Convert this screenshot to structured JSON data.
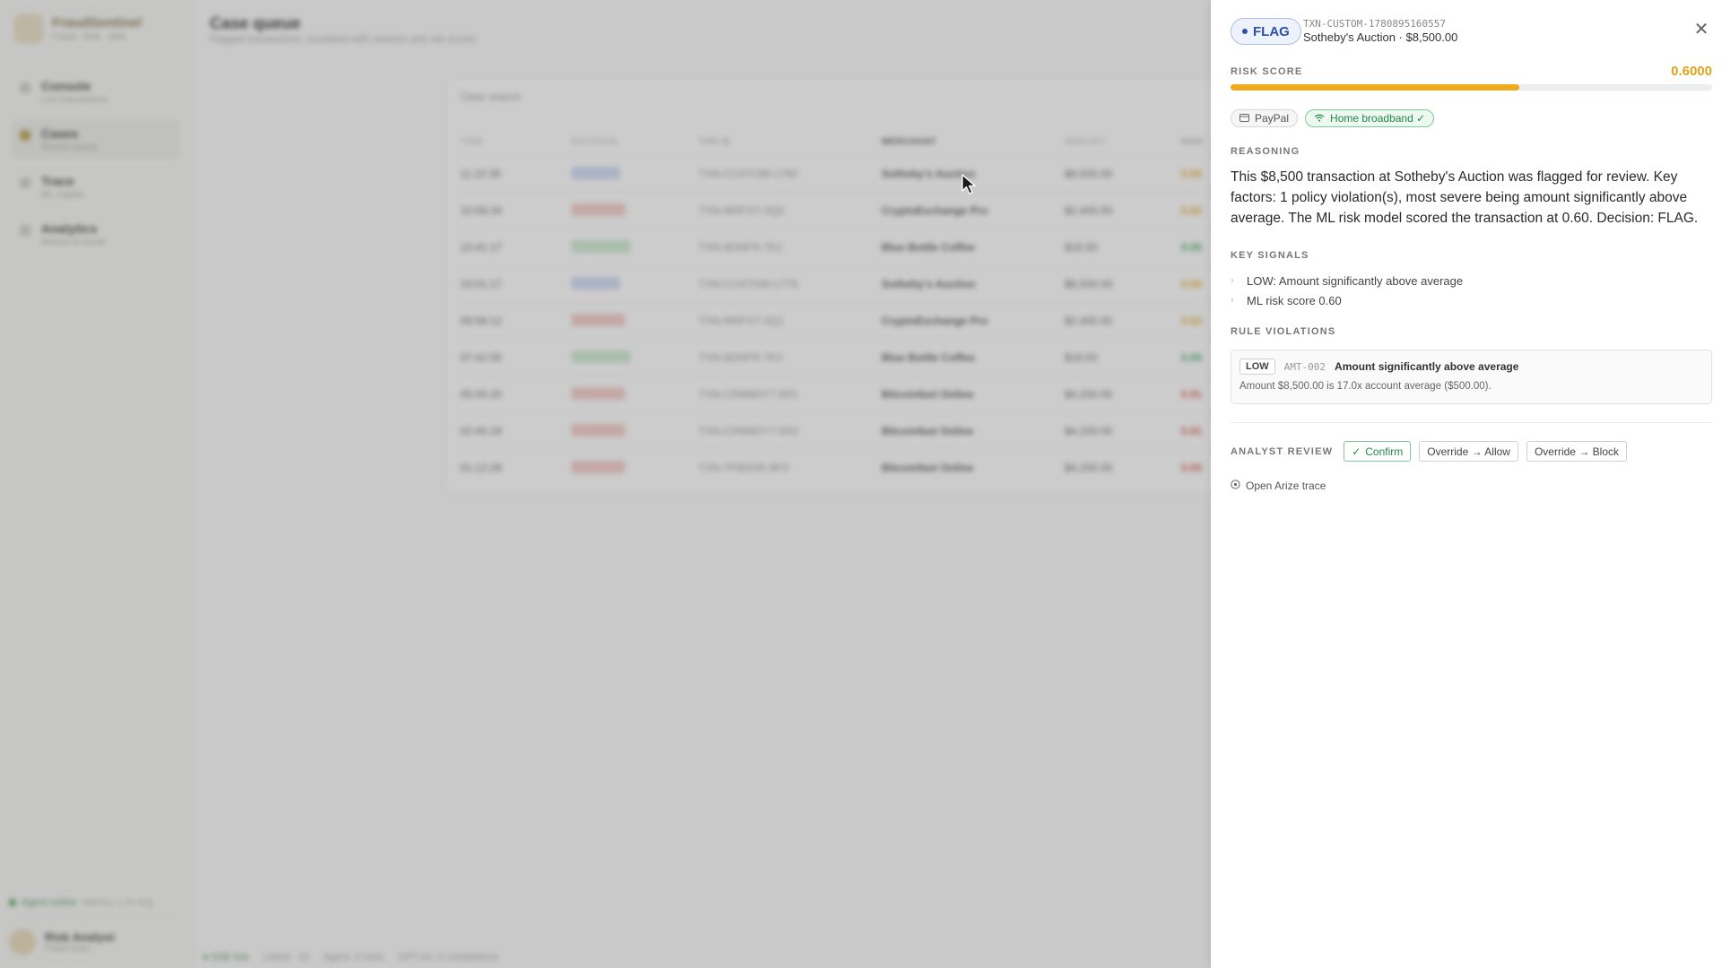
{
  "sidebar": {
    "brand": {
      "name": "FraudSentinel",
      "subtitle": "Fraud · Risk · AML"
    },
    "items": [
      {
        "label": "Console",
        "sub": "Live transactions"
      },
      {
        "label": "Cases",
        "sub": "Review queue"
      },
      {
        "label": "Trace",
        "sub": "ML explain"
      },
      {
        "label": "Analytics",
        "sub": "Metrics & trends"
      }
    ],
    "status": {
      "label": "Agent online",
      "detail": "latency 1.2s avg"
    },
    "user": {
      "name": "Risk Analyst",
      "role": "Fraud team"
    }
  },
  "main": {
    "title": "Case queue",
    "subtitle": "Flagged transactions, escalated with reasons and risk scores",
    "clear_label": "Clear search",
    "columns": [
      "TIME",
      "DECISION",
      "TXN ID",
      "MERCHANT",
      "AMOUNT",
      "RISK"
    ],
    "rows": [
      {
        "time": "11:22:35",
        "decision": "blue",
        "txn": "TXN-CUSTOM-1780",
        "merchant": "Sotheby's Auction",
        "amount": "$8,500.00",
        "risk": "0.60"
      },
      {
        "time": "10:58:34",
        "decision": "red",
        "txn": "TXN-MRFX7-3Q0",
        "merchant": "CryptoExchange Pro",
        "amount": "$2,400.00",
        "risk": "0.62"
      },
      {
        "time": "10:41:17",
        "decision": "green",
        "txn": "TXN-8DNFR-7K2",
        "merchant": "Blue Bottle Coffee",
        "amount": "$18.50",
        "risk": "0.05"
      },
      {
        "time": "10:01:17",
        "decision": "blue",
        "txn": "TXN-CUSTOM-1779",
        "merchant": "Sotheby's Auction",
        "amount": "$8,500.00",
        "risk": "0.60"
      },
      {
        "time": "09:58:12",
        "decision": "red",
        "txn": "TXN-MRFX7-3Q1",
        "merchant": "CryptoExchange Pro",
        "amount": "$2,400.00",
        "risk": "0.62"
      },
      {
        "time": "07:42:55",
        "decision": "green",
        "txn": "TXN-8DNFR-7K3",
        "merchant": "Blue Bottle Coffee",
        "amount": "$18.50",
        "risk": "0.05"
      },
      {
        "time": "05:05:20",
        "decision": "red",
        "txn": "TXN-CRM8DY7-5R1",
        "merchant": "Bitcoinfast Online",
        "amount": "$4,200.00",
        "risk": "0.91"
      },
      {
        "time": "02:45:18",
        "decision": "red",
        "txn": "TXN-CRM8DY7-5R2",
        "merchant": "Bitcoinfast Online",
        "amount": "$4,200.00",
        "risk": "0.91"
      },
      {
        "time": "01:12:28",
        "decision": "red",
        "txn": "TXN-7F8DHR-9P3",
        "merchant": "Bitcoinfast Online",
        "amount": "$4,200.00",
        "risk": "0.93"
      }
    ],
    "footer": [
      "● SSE live",
      "Latest · 2s",
      "Agent: 4 tools",
      "GPT-4o: 2 completions"
    ]
  },
  "drawer": {
    "decision": "FLAG",
    "txn_id": "TXN-CUSTOM-1780895160557",
    "merchant_amount": "Sotheby's Auction · $8,500.00",
    "risk_label": "RISK SCORE",
    "risk_value": "0.6000",
    "risk_fraction": 0.6,
    "chips": [
      {
        "label": "PayPal",
        "icon": "card-icon"
      },
      {
        "label": "Home broadband ✓",
        "icon": "wifi-icon"
      }
    ],
    "reasoning_label": "REASONING",
    "reasoning": "This $8,500 transaction at Sotheby's Auction was flagged for review. Key factors: 1 policy violation(s), most severe being amount significantly above average. The ML risk model scored the transaction at 0.60. Decision: FLAG.",
    "signals_label": "KEY SIGNALS",
    "signals": [
      "LOW: Amount significantly above average",
      "ML risk score 0.60"
    ],
    "violations_label": "RULE VIOLATIONS",
    "violation": {
      "severity": "LOW",
      "code": "AMT-002",
      "title": "Amount significantly above average",
      "description": "Amount $8,500.00 is 17.0x account average ($500.00)."
    },
    "review_label": "ANALYST REVIEW",
    "buttons": {
      "confirm": "Confirm",
      "allow": "Override → Allow",
      "block": "Override → Block"
    },
    "trace_label": "Open Arize trace"
  },
  "colors": {
    "accent_flag": "#2d4fa8",
    "risk": "#f0ab1c",
    "ok": "#24884a"
  }
}
